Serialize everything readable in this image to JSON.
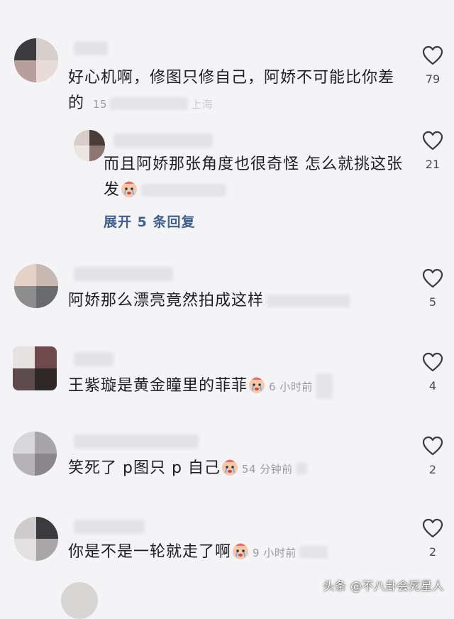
{
  "comments": [
    {
      "text": "好心机啊，修图只修自己，阿娇不可能比你差的",
      "meta": "15",
      "meta_tail": "上海",
      "likes": "79"
    },
    {
      "text": "而且阿娇那张角度也很奇怪 怎么就挑这张发",
      "meta": "",
      "likes": "21"
    },
    {
      "text": "阿娇那么漂亮竟然拍成这样",
      "meta": "",
      "likes": "5"
    },
    {
      "text": "王紫璇是黄金瞳里的菲菲",
      "meta": "6 小时前",
      "likes": "4"
    },
    {
      "text": "笑死了 p图只 p 自己",
      "meta": "54 分钟前",
      "likes": "2"
    },
    {
      "text": "你是不是一轮就走了啊",
      "meta": "9 小时前",
      "likes": "2"
    }
  ],
  "reply_line1": "而且阿娇那张角度也很奇怪 怎么就挑这张",
  "reply_line2": "发",
  "c1_line1": "好心机啊，修图只修自己，阿娇不可能比你差",
  "c1_line2": "的",
  "expand_replies": "展开 5 条回复",
  "watermark": "头条 @不八卦会死星人",
  "icons": {
    "like": "heart-outline-icon",
    "emoji": "crying-emoji-icon"
  }
}
